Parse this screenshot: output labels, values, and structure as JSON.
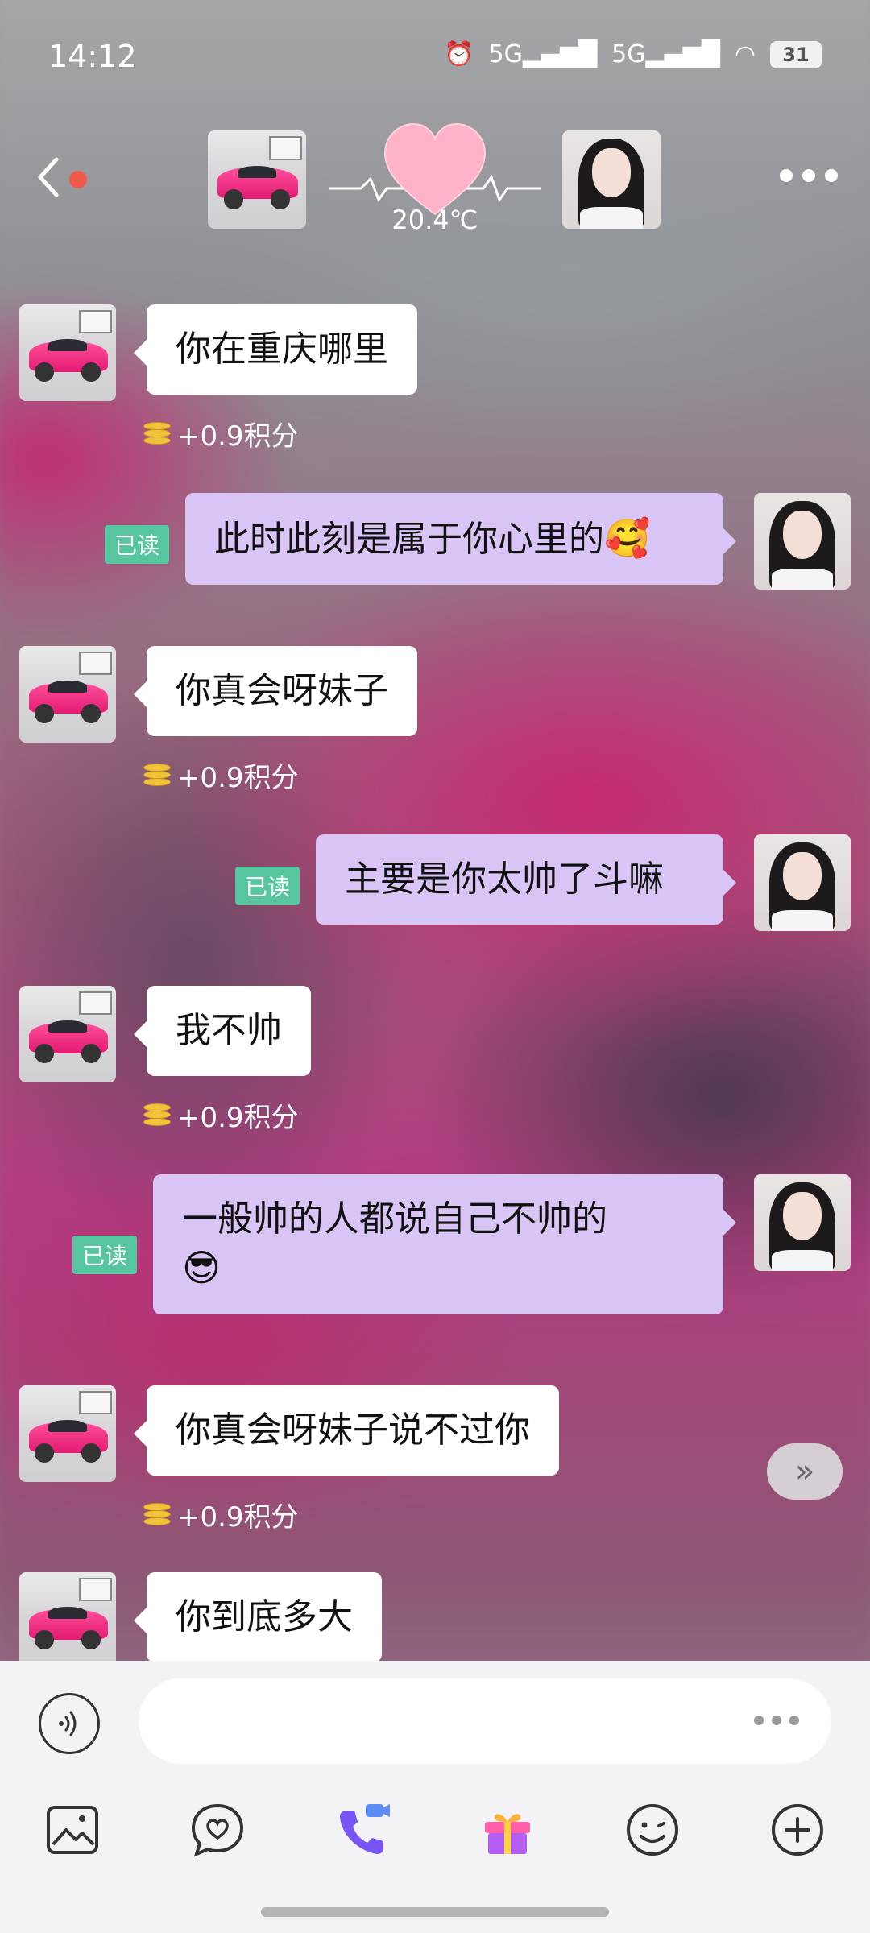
{
  "status_bar": {
    "time": "14:12",
    "battery": "31",
    "network1": "5G",
    "network2": "5G"
  },
  "header": {
    "temperature": "20.4℃"
  },
  "messages": [
    {
      "side": "in",
      "text": "你在重庆哪里",
      "points": "+0.9积分"
    },
    {
      "side": "out",
      "text": "此时此刻是属于你心里的",
      "emoji": "🥰",
      "read": "已读"
    },
    {
      "side": "in",
      "text": "你真会呀妹子",
      "points": "+0.9积分"
    },
    {
      "side": "out",
      "text": "主要是你太帅了斗嘛",
      "read": "已读"
    },
    {
      "side": "in",
      "text": "我不帅",
      "points": "+0.9积分"
    },
    {
      "side": "out",
      "text": "一般帅的人都说自己不帅的",
      "emoji": "😎",
      "read": "已读"
    },
    {
      "side": "in",
      "text": "你真会呀妹子说不过你",
      "points": "+0.9积分"
    },
    {
      "side": "in",
      "text": "你到底多大"
    }
  ],
  "scroll_button": {
    "label": "»"
  },
  "colors": {
    "out_bubble": "#d8c5f6",
    "in_bubble": "#ffffff",
    "read_badge": "#57c6a0",
    "accent": "#8a5cf5"
  }
}
